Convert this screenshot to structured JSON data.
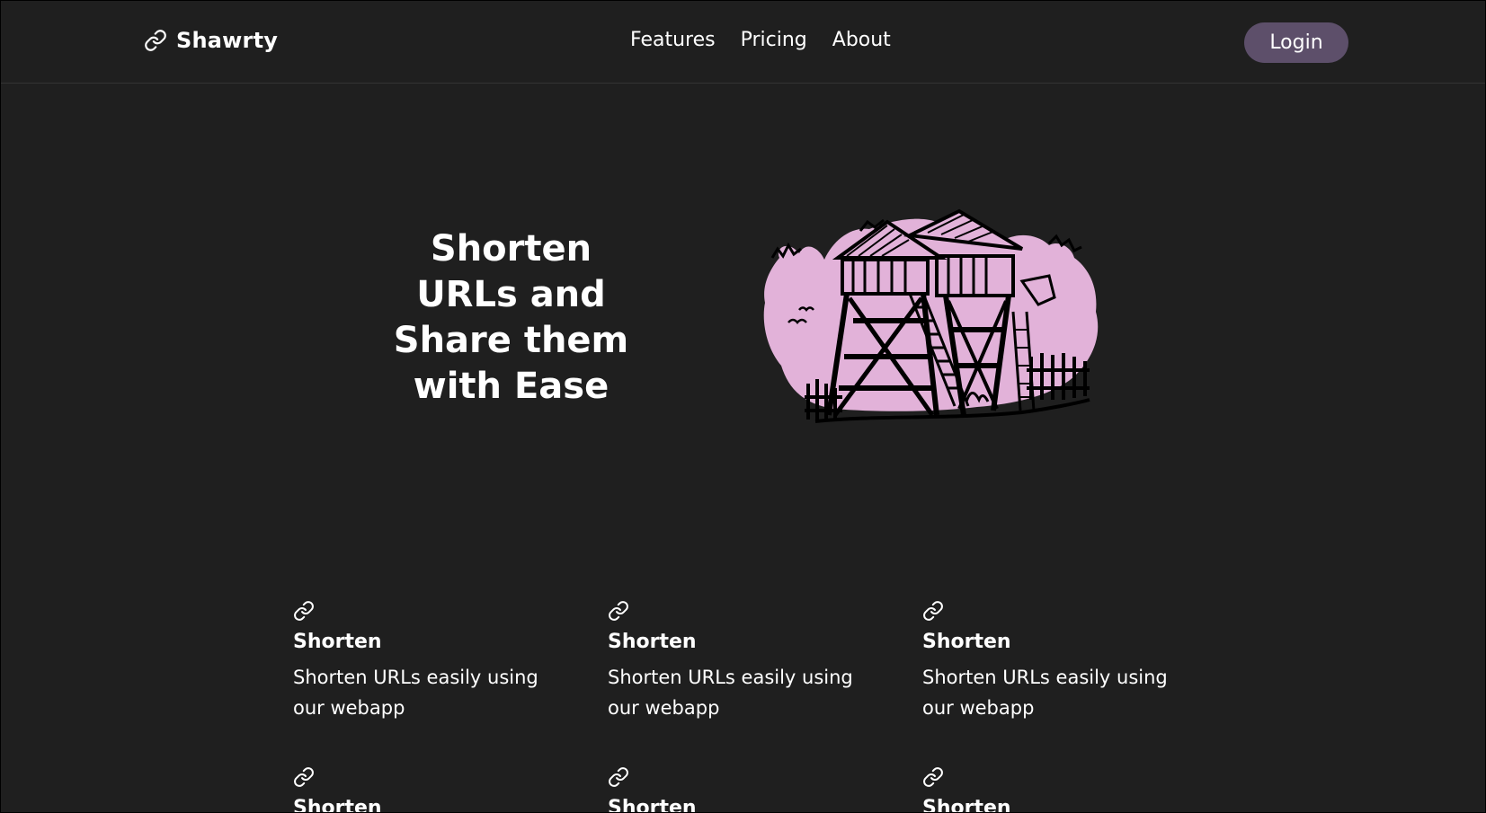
{
  "header": {
    "brand": "Shawrty",
    "nav": [
      "Features",
      "Pricing",
      "About"
    ],
    "login_label": "Login"
  },
  "hero": {
    "title": "Shorten URLs and Share them with Ease",
    "illustration": "watchtower-illustration"
  },
  "features": [
    {
      "icon": "link-icon",
      "title": "Shorten",
      "description": "Shorten URLs easily using our webapp"
    },
    {
      "icon": "link-icon",
      "title": "Shorten",
      "description": "Shorten URLs easily using our webapp"
    },
    {
      "icon": "link-icon",
      "title": "Shorten",
      "description": "Shorten URLs easily using our webapp"
    },
    {
      "icon": "link-icon",
      "title": "Shorten",
      "description": ""
    },
    {
      "icon": "link-icon",
      "title": "Shorten",
      "description": ""
    },
    {
      "icon": "link-icon",
      "title": "Shorten",
      "description": ""
    }
  ],
  "colors": {
    "background": "#1f1f1f",
    "login_button": "#5d4f6a",
    "illustration_fill": "#e2b2d9",
    "text": "#ffffff"
  }
}
